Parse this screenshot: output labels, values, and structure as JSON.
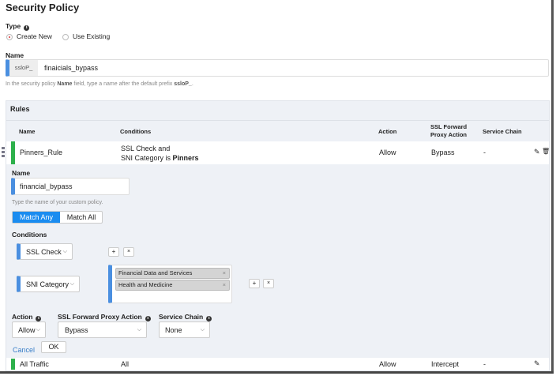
{
  "title": "Security Policy",
  "type": {
    "label": "Type",
    "options": [
      "Create New",
      "Use Existing"
    ],
    "selected": "Create New"
  },
  "name": {
    "label": "Name",
    "prefix": "ssloP_",
    "value": "finaicials_bypass",
    "hint_pre": "In the security policy ",
    "hint_bold": "Name",
    "hint_mid": " field, type a name after the default prefix ",
    "hint_prefix": "ssloP_",
    "hint_end": "."
  },
  "rules": {
    "title": "Rules",
    "columns": [
      "Name",
      "Conditions",
      "Action",
      "SSL Forward Proxy Action",
      "Service Chain"
    ],
    "rows": [
      {
        "name": "Pinners_Rule",
        "cond1": "SSL Check  and",
        "cond2_pre": "SNI Category  is ",
        "cond2_bold": "Pinners",
        "action": "Allow",
        "ssl": "Bypass",
        "chain": "-"
      },
      {
        "name": "All Traffic",
        "cond1": "All",
        "action": "Allow",
        "ssl": "Intercept",
        "chain": "-"
      }
    ]
  },
  "editor": {
    "name_label": "Name",
    "name_value": "financial_bypass",
    "name_hint": "Type the name of your custom policy.",
    "match": [
      "Match Any",
      "Match All"
    ],
    "match_selected": "Match Any",
    "conditions_label": "Conditions",
    "conditions": [
      {
        "type": "SSL Check"
      },
      {
        "type": "SNI Category",
        "values": [
          "Financial Data and Services",
          "Health and Medicine"
        ]
      }
    ],
    "action_label": "Action",
    "action_value": "Allow",
    "ssl_label": "SSL Forward Proxy Action",
    "ssl_value": "Bypass",
    "chain_label": "Service Chain",
    "chain_value": "None",
    "cancel": "Cancel",
    "ok": "OK"
  },
  "colors": {
    "accent": "#4a8fe0",
    "rule_ok": "#2db04b",
    "primary_btn": "#1a8cf0"
  }
}
